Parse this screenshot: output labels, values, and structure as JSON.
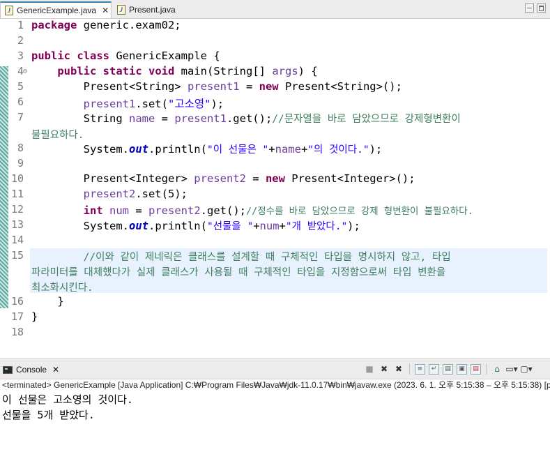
{
  "tabs": [
    {
      "label": "GenericExample.java",
      "active": true
    },
    {
      "label": "Present.java",
      "active": false
    }
  ],
  "editor": {
    "line_numbers": [
      "1",
      "2",
      "3",
      "4",
      "5",
      "6",
      "7",
      "8",
      "9",
      "10",
      "11",
      "12",
      "13",
      "14",
      "15",
      "16",
      "17",
      "18"
    ],
    "lines": {
      "l1_kw": "package",
      "l1_rest": " generic.exam02;",
      "l3_kw1": "public",
      "l3_kw2": "class",
      "l3_rest": " GenericExample {",
      "l4_kw1": "public",
      "l4_kw2": "static",
      "l4_kw3": "void",
      "l4_rest": " main(String[] ",
      "l4_arg": "args",
      "l4_end": ") {",
      "l5_a": "Present<String> ",
      "l5_var": "present1",
      "l5_b": " = ",
      "l5_kw": "new",
      "l5_c": " Present<String>();",
      "l6_var": "present1",
      "l6_a": ".set(",
      "l6_str": "\"고소영\"",
      "l6_b": ");",
      "l7_a": "String ",
      "l7_var": "name",
      "l7_b": " = ",
      "l7_var2": "present1",
      "l7_c": ".get();",
      "l7_cmt": "//문자열을 바로 담았으므로 강제형변환이",
      "l7_wrap": "불필요하다.",
      "l8_a": "System.",
      "l8_out": "out",
      "l8_b": ".println(",
      "l8_s1": "\"이 선물은 \"",
      "l8_c": "+",
      "l8_var": "name",
      "l8_d": "+",
      "l8_s2": "\"의 것이다.\"",
      "l8_e": ");",
      "l10_a": "Present<Integer> ",
      "l10_var": "present2",
      "l10_b": " = ",
      "l10_kw": "new",
      "l10_c": " Present<Integer>();",
      "l11_var": "present2",
      "l11_a": ".set(5);",
      "l12_kw": "int",
      "l12_a": " ",
      "l12_var": "num",
      "l12_b": " = ",
      "l12_var2": "present2",
      "l12_c": ".get();",
      "l12_cmt": "//정수를 바로 담았으므로 강제 형변환이 불필요하다.",
      "l13_a": "System.",
      "l13_out": "out",
      "l13_b": ".println(",
      "l13_s1": "\"선물을 \"",
      "l13_c": "+",
      "l13_var": "num",
      "l13_d": "+",
      "l13_s2": "\"개 받았다.\"",
      "l13_e": ");",
      "l15_cmt": "//이와 같이 제네릭은 클래스를 설계할 때 구체적인 타입을 명시하지 않고, 타입",
      "l15_wrap1": "파라미터를 대체했다가 실제 클래스가 사용될 때 구체적인 타입을 지정함으로써 타입 변환을",
      "l15_wrap2": "최소화시킨다.",
      "l16": "}",
      "l17": "}"
    }
  },
  "console": {
    "tab_label": "Console",
    "status": "<terminated> GenericExample [Java Application] C:₩Program Files₩Java₩jdk-11.0.17₩bin₩javaw.exe  (2023. 6. 1. 오후 5:15:38 – 오후 5:15:38) [p",
    "output": [
      "이 선물은 고소영의 것이다.",
      "선물을 5개 받았다."
    ]
  },
  "icons": [
    "java-file-icon",
    "close-icon",
    "minimize-icon",
    "maximize-icon",
    "console-icon",
    "terminate-icon",
    "remove-launch-icon",
    "remove-all-icon",
    "scroll-lock-icon",
    "word-wrap-icon",
    "show-on-output-icon",
    "show-on-error-icon",
    "pin-console-icon",
    "display-console-icon",
    "open-console-icon",
    "view-menu-icon"
  ],
  "colors": {
    "keyword": "#7f0055",
    "string": "#2a00ff",
    "comment": "#3f7f5f",
    "field": "#6a3e9c",
    "static_field": "#0000c0",
    "current_line": "#e8f2fe"
  }
}
